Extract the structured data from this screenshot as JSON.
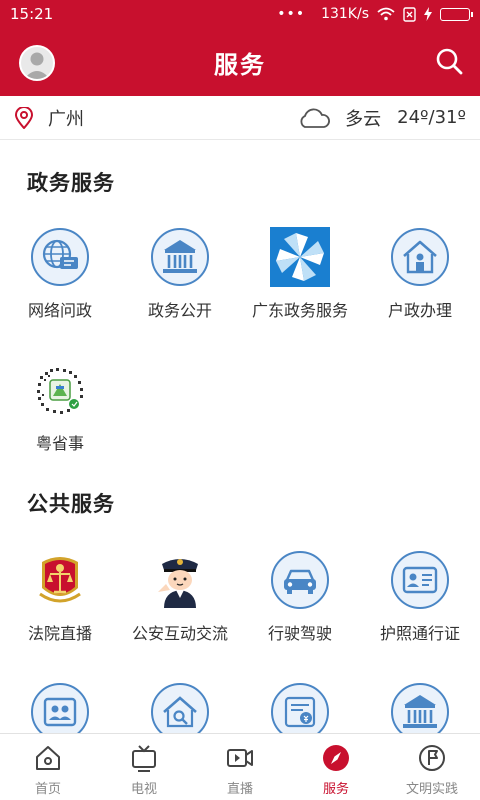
{
  "status_bar": {
    "time": "15:21",
    "dots": "•••",
    "network_speed": "131K/s"
  },
  "header": {
    "title": "服务"
  },
  "weather": {
    "city": "广州",
    "condition": "多云",
    "temperature": "24º/31º"
  },
  "sections": [
    {
      "title": "政务服务",
      "items": [
        {
          "label": "网络问政",
          "icon": "globe-chat-icon"
        },
        {
          "label": "政务公开",
          "icon": "government-building-icon"
        },
        {
          "label": "广东政务服务",
          "icon": "pinwheel-logo-icon"
        },
        {
          "label": "户政办理",
          "icon": "household-person-icon"
        },
        {
          "label": "粤省事",
          "icon": "qr-code-icon"
        }
      ]
    },
    {
      "title": "公共服务",
      "items": [
        {
          "label": "法院直播",
          "icon": "court-emblem-icon"
        },
        {
          "label": "公安互动交流",
          "icon": "police-officer-icon"
        },
        {
          "label": "行驶驾驶",
          "icon": "car-icon"
        },
        {
          "label": "护照通行证",
          "icon": "id-card-icon"
        }
      ]
    }
  ],
  "tab_bar": {
    "tabs": [
      {
        "label": "首页",
        "icon": "home-icon"
      },
      {
        "label": "电视",
        "icon": "tv-icon"
      },
      {
        "label": "直播",
        "icon": "video-icon"
      },
      {
        "label": "服务",
        "icon": "compass-icon",
        "active": true
      },
      {
        "label": "文明实践",
        "icon": "flag-circle-icon"
      }
    ]
  },
  "colors": {
    "brand": "#c8102e",
    "icon_blue": "#4a86c5",
    "icon_blue_light": "#eaf2fb"
  }
}
